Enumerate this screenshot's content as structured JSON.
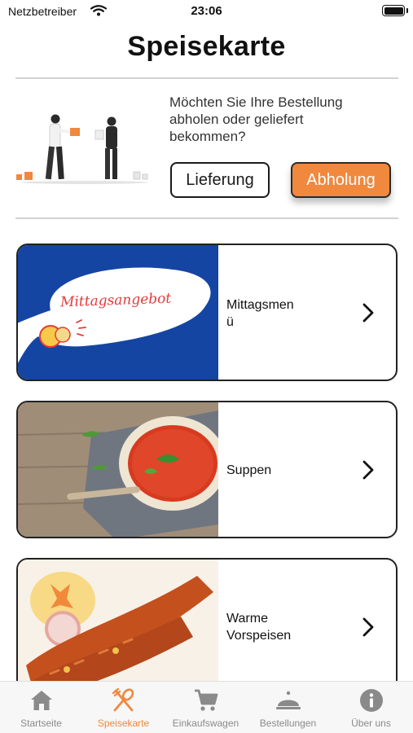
{
  "status_bar": {
    "carrier": "Netzbetreiber",
    "time": "23:06"
  },
  "page": {
    "title": "Speisekarte"
  },
  "delivery": {
    "question": "Möchten Sie Ihre Bestellung abholen oder geliefert bekommen?",
    "delivery_label": "Lieferung",
    "pickup_label": "Abholung",
    "accent_color": "#f0883e"
  },
  "menu": {
    "categories": [
      {
        "label": "Mittagsmen\nü",
        "image_text": "Mittagsangebot",
        "icon": "chevron-right-icon"
      },
      {
        "label": "Suppen",
        "icon": "chevron-right-icon"
      },
      {
        "label": "Warme\nVorspeisen",
        "icon": "chevron-right-icon"
      }
    ]
  },
  "tab_bar": {
    "items": [
      {
        "label": "Startseite",
        "icon": "home-icon",
        "active": false
      },
      {
        "label": "Speisekarte",
        "icon": "fork-spoon-icon",
        "active": true
      },
      {
        "label": "Einkaufswagen",
        "icon": "cart-icon",
        "active": false
      },
      {
        "label": "Bestellungen",
        "icon": "cloche-icon",
        "active": false
      },
      {
        "label": "Über uns",
        "icon": "info-icon",
        "active": false
      }
    ]
  }
}
